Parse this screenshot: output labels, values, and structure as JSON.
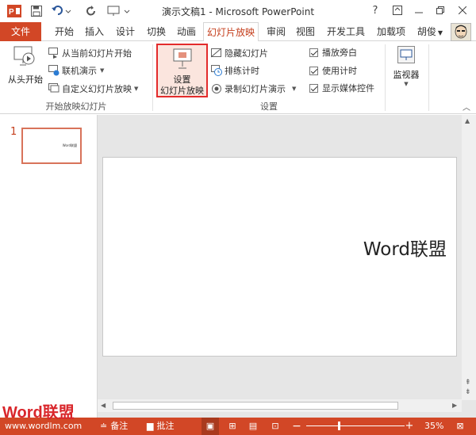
{
  "window": {
    "title": "演示文稿1 - Microsoft PowerPoint",
    "help": "?",
    "user_name": "胡俊"
  },
  "tabs": [
    "文件",
    "开始",
    "插入",
    "设计",
    "切换",
    "动画",
    "幻灯片放映",
    "审阅",
    "视图",
    "开发工具",
    "加载项"
  ],
  "ribbon": {
    "start_group": {
      "from_beginning": "从头开始",
      "from_current": "从当前幻灯片开始",
      "present_online": "联机演示",
      "custom_show": "自定义幻灯片放映",
      "label": "开始放映幻灯片"
    },
    "setup_group": {
      "setup_line1": "设置",
      "setup_line2": "幻灯片放映",
      "hide_slide": "隐藏幻灯片",
      "rehearse": "排练计时",
      "record": "录制幻灯片演示",
      "play_narrations": "播放旁白",
      "use_timings": "使用计时",
      "show_media_controls": "显示媒体控件",
      "label": "设置"
    },
    "monitors_group": {
      "monitor": "监视器"
    }
  },
  "slides": {
    "thumb_number": "1",
    "thumb_text": "Word联盟",
    "slide_text": "Word联盟"
  },
  "status": {
    "logo": "Word联盟",
    "url": "www.wordlm.com",
    "notes": "备注",
    "comments": "批注",
    "zoom_minus": "−",
    "zoom_plus": "+",
    "zoom": "35%"
  },
  "colors": {
    "accent": "#d24726",
    "highlight": "#d24726"
  }
}
